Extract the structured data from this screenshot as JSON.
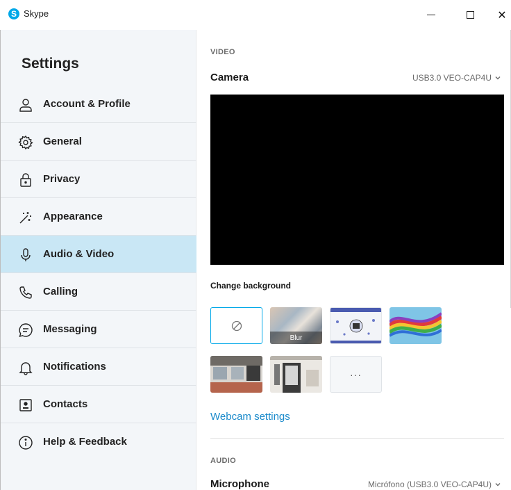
{
  "window": {
    "app_icon_letter": "S",
    "title": "Skype",
    "minimize_icon": "minimize-icon",
    "maximize_icon": "maximize-icon",
    "close_glyph": "✕"
  },
  "sidebar": {
    "heading": "Settings",
    "items": [
      {
        "label": "Account & Profile",
        "icon": "user-icon"
      },
      {
        "label": "General",
        "icon": "gear-icon"
      },
      {
        "label": "Privacy",
        "icon": "lock-icon"
      },
      {
        "label": "Appearance",
        "icon": "magic-wand-icon"
      },
      {
        "label": "Audio & Video",
        "icon": "microphone-icon",
        "active": true
      },
      {
        "label": "Calling",
        "icon": "phone-icon"
      },
      {
        "label": "Messaging",
        "icon": "chat-icon"
      },
      {
        "label": "Notifications",
        "icon": "bell-icon"
      },
      {
        "label": "Contacts",
        "icon": "contact-card-icon"
      },
      {
        "label": "Help & Feedback",
        "icon": "info-icon"
      }
    ]
  },
  "video": {
    "section_label": "VIDEO",
    "camera_label": "Camera",
    "camera_value": "USB3.0 VEO-CAP4U",
    "change_background_label": "Change background",
    "backgrounds": [
      {
        "kind": "none",
        "icon": "no-background-icon"
      },
      {
        "kind": "blur",
        "label": "Blur"
      },
      {
        "kind": "image",
        "name": "snow-pattern"
      },
      {
        "kind": "image",
        "name": "colorful-ribbons"
      },
      {
        "kind": "image",
        "name": "office-room"
      },
      {
        "kind": "image",
        "name": "doorway-room"
      },
      {
        "kind": "more",
        "label": "···"
      }
    ],
    "webcam_settings_link": "Webcam settings"
  },
  "audio": {
    "section_label": "AUDIO",
    "microphone_label": "Microphone",
    "microphone_value": "Micrófono (USB3.0 VEO-CAP4U)"
  },
  "colors": {
    "accent": "#00a8e8",
    "link": "#1a8acb",
    "active_item_bg": "#c9e7f5",
    "sidebar_bg": "#f3f6f9"
  }
}
